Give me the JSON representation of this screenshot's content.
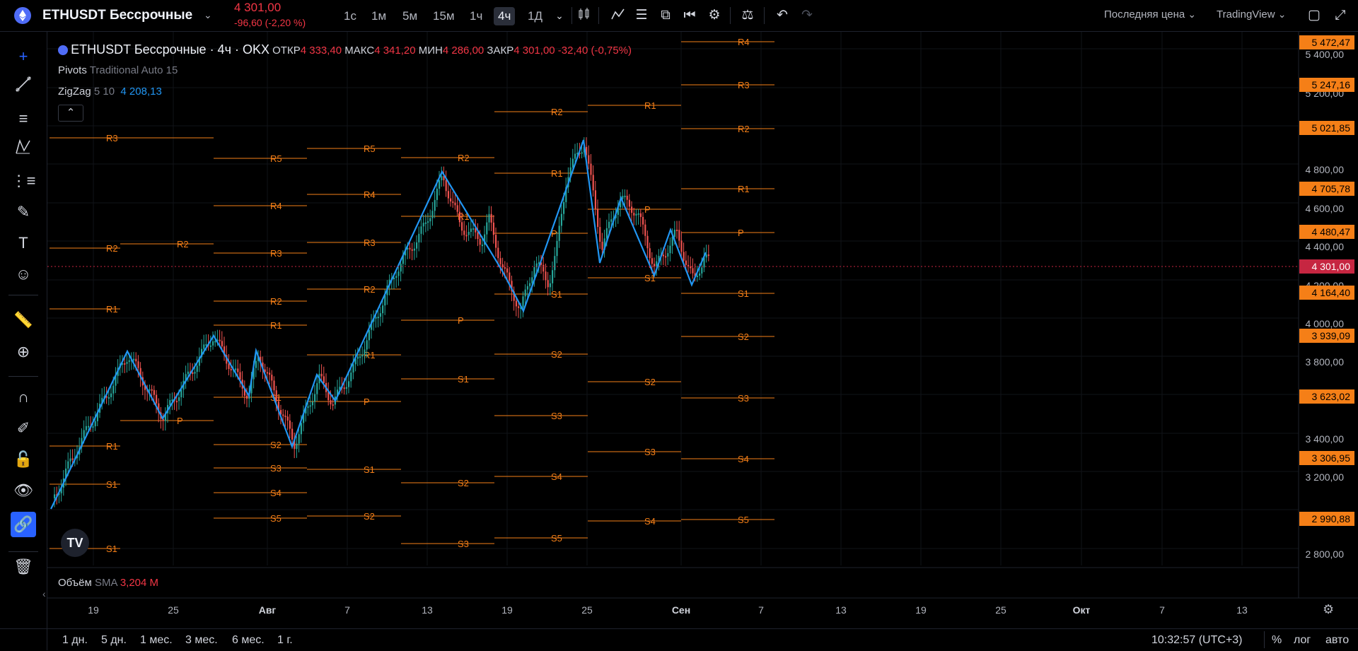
{
  "header": {
    "symbol": "ETHUSDT Бессрочные",
    "last_price": "4 301,00",
    "change": "-96,60 (-2,20 %)",
    "timeframes": [
      "1с",
      "1м",
      "5м",
      "15м",
      "1ч",
      "4ч",
      "1Д"
    ],
    "active_timeframe": "4ч",
    "price_type": "Последняя цена",
    "layout_name": "TradingView"
  },
  "legend": {
    "title": "ETHUSDT Бессрочные · 4ч · OKX",
    "open_label": "ОТКР",
    "open": "4 333,40",
    "high_label": "МАКС",
    "high": "4 341,20",
    "low_label": "МИН",
    "low": "4 286,00",
    "close_label": "ЗАКР",
    "close": "4 301,00",
    "change": "-32,40 (-0,75%)",
    "pivots_name": "Pivots",
    "pivots_params": "Traditional Auto 15",
    "zigzag_name": "ZigZag",
    "zigzag_params": "5 10",
    "zigzag_value": "4 208,13",
    "volume_name": "Объём",
    "volume_ma": "SMA",
    "volume_value": "3,204 M"
  },
  "price_axis": {
    "ticks": [
      "5 400,00",
      "5 200,00",
      "4 800,00",
      "4 600,00",
      "4 400,00",
      "4 200,00",
      "4 000,00",
      "3 800,00",
      "3 400,00",
      "3 200,00",
      "2 800,00"
    ],
    "badges": [
      "5 472,47",
      "5 247,16",
      "5 021,85",
      "4 705,78",
      "4 480,47",
      "4 301,00",
      "4 164,40",
      "3 939,09",
      "3 623,02",
      "3 306,95",
      "2 990,88"
    ]
  },
  "time_axis": {
    "ticks": [
      "19",
      "25",
      "Авг",
      "7",
      "13",
      "19",
      "25",
      "Сен",
      "7",
      "13",
      "19",
      "25",
      "Окт",
      "7",
      "13"
    ]
  },
  "bottom": {
    "ranges": [
      "1 дн.",
      "5 дн.",
      "1 мес.",
      "3 мес.",
      "6 мес.",
      "1 г."
    ],
    "clock": "10:32:57 (UTC+3)",
    "percent": "%",
    "log": "лог",
    "auto": "авто"
  },
  "pivot_labels": {
    "r1": "R1",
    "r2": "R2",
    "r3": "R3",
    "r4": "R4",
    "r5": "R5",
    "p": "P",
    "s1": "S1",
    "s2": "S2",
    "s3": "S3",
    "s4": "S4",
    "s5": "S5"
  },
  "colors": {
    "pivot": "#f57f17",
    "zigzag": "#2196f3",
    "up": "#26a69a",
    "down": "#ef5350",
    "price_line": "#c62641"
  },
  "icons": {
    "symbol_logo": "ethereum-icon",
    "logo": "tradingview-logo"
  }
}
